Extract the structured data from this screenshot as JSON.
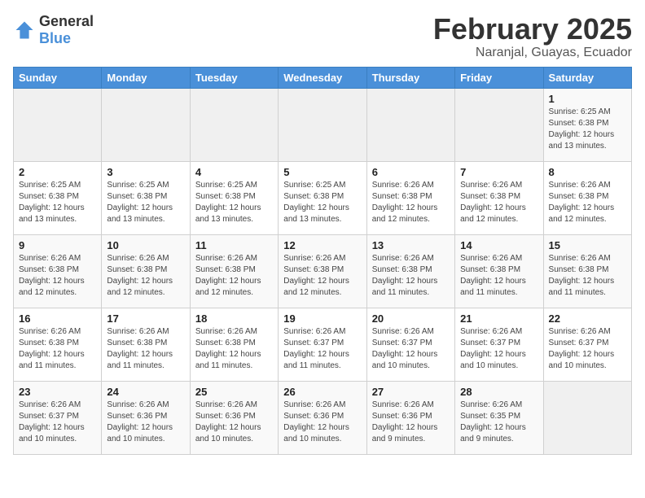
{
  "logo": {
    "general": "General",
    "blue": "Blue"
  },
  "header": {
    "month": "February 2025",
    "location": "Naranjal, Guayas, Ecuador"
  },
  "weekdays": [
    "Sunday",
    "Monday",
    "Tuesday",
    "Wednesday",
    "Thursday",
    "Friday",
    "Saturday"
  ],
  "weeks": [
    [
      {
        "day": "",
        "empty": true
      },
      {
        "day": "",
        "empty": true
      },
      {
        "day": "",
        "empty": true
      },
      {
        "day": "",
        "empty": true
      },
      {
        "day": "",
        "empty": true
      },
      {
        "day": "",
        "empty": true
      },
      {
        "day": "1",
        "sunrise": "Sunrise: 6:25 AM",
        "sunset": "Sunset: 6:38 PM",
        "daylight": "Daylight: 12 hours and 13 minutes."
      }
    ],
    [
      {
        "day": "2",
        "sunrise": "Sunrise: 6:25 AM",
        "sunset": "Sunset: 6:38 PM",
        "daylight": "Daylight: 12 hours and 13 minutes."
      },
      {
        "day": "3",
        "sunrise": "Sunrise: 6:25 AM",
        "sunset": "Sunset: 6:38 PM",
        "daylight": "Daylight: 12 hours and 13 minutes."
      },
      {
        "day": "4",
        "sunrise": "Sunrise: 6:25 AM",
        "sunset": "Sunset: 6:38 PM",
        "daylight": "Daylight: 12 hours and 13 minutes."
      },
      {
        "day": "5",
        "sunrise": "Sunrise: 6:25 AM",
        "sunset": "Sunset: 6:38 PM",
        "daylight": "Daylight: 12 hours and 13 minutes."
      },
      {
        "day": "6",
        "sunrise": "Sunrise: 6:26 AM",
        "sunset": "Sunset: 6:38 PM",
        "daylight": "Daylight: 12 hours and 12 minutes."
      },
      {
        "day": "7",
        "sunrise": "Sunrise: 6:26 AM",
        "sunset": "Sunset: 6:38 PM",
        "daylight": "Daylight: 12 hours and 12 minutes."
      },
      {
        "day": "8",
        "sunrise": "Sunrise: 6:26 AM",
        "sunset": "Sunset: 6:38 PM",
        "daylight": "Daylight: 12 hours and 12 minutes."
      }
    ],
    [
      {
        "day": "9",
        "sunrise": "Sunrise: 6:26 AM",
        "sunset": "Sunset: 6:38 PM",
        "daylight": "Daylight: 12 hours and 12 minutes."
      },
      {
        "day": "10",
        "sunrise": "Sunrise: 6:26 AM",
        "sunset": "Sunset: 6:38 PM",
        "daylight": "Daylight: 12 hours and 12 minutes."
      },
      {
        "day": "11",
        "sunrise": "Sunrise: 6:26 AM",
        "sunset": "Sunset: 6:38 PM",
        "daylight": "Daylight: 12 hours and 12 minutes."
      },
      {
        "day": "12",
        "sunrise": "Sunrise: 6:26 AM",
        "sunset": "Sunset: 6:38 PM",
        "daylight": "Daylight: 12 hours and 12 minutes."
      },
      {
        "day": "13",
        "sunrise": "Sunrise: 6:26 AM",
        "sunset": "Sunset: 6:38 PM",
        "daylight": "Daylight: 12 hours and 11 minutes."
      },
      {
        "day": "14",
        "sunrise": "Sunrise: 6:26 AM",
        "sunset": "Sunset: 6:38 PM",
        "daylight": "Daylight: 12 hours and 11 minutes."
      },
      {
        "day": "15",
        "sunrise": "Sunrise: 6:26 AM",
        "sunset": "Sunset: 6:38 PM",
        "daylight": "Daylight: 12 hours and 11 minutes."
      }
    ],
    [
      {
        "day": "16",
        "sunrise": "Sunrise: 6:26 AM",
        "sunset": "Sunset: 6:38 PM",
        "daylight": "Daylight: 12 hours and 11 minutes."
      },
      {
        "day": "17",
        "sunrise": "Sunrise: 6:26 AM",
        "sunset": "Sunset: 6:38 PM",
        "daylight": "Daylight: 12 hours and 11 minutes."
      },
      {
        "day": "18",
        "sunrise": "Sunrise: 6:26 AM",
        "sunset": "Sunset: 6:38 PM",
        "daylight": "Daylight: 12 hours and 11 minutes."
      },
      {
        "day": "19",
        "sunrise": "Sunrise: 6:26 AM",
        "sunset": "Sunset: 6:37 PM",
        "daylight": "Daylight: 12 hours and 11 minutes."
      },
      {
        "day": "20",
        "sunrise": "Sunrise: 6:26 AM",
        "sunset": "Sunset: 6:37 PM",
        "daylight": "Daylight: 12 hours and 10 minutes."
      },
      {
        "day": "21",
        "sunrise": "Sunrise: 6:26 AM",
        "sunset": "Sunset: 6:37 PM",
        "daylight": "Daylight: 12 hours and 10 minutes."
      },
      {
        "day": "22",
        "sunrise": "Sunrise: 6:26 AM",
        "sunset": "Sunset: 6:37 PM",
        "daylight": "Daylight: 12 hours and 10 minutes."
      }
    ],
    [
      {
        "day": "23",
        "sunrise": "Sunrise: 6:26 AM",
        "sunset": "Sunset: 6:37 PM",
        "daylight": "Daylight: 12 hours and 10 minutes."
      },
      {
        "day": "24",
        "sunrise": "Sunrise: 6:26 AM",
        "sunset": "Sunset: 6:36 PM",
        "daylight": "Daylight: 12 hours and 10 minutes."
      },
      {
        "day": "25",
        "sunrise": "Sunrise: 6:26 AM",
        "sunset": "Sunset: 6:36 PM",
        "daylight": "Daylight: 12 hours and 10 minutes."
      },
      {
        "day": "26",
        "sunrise": "Sunrise: 6:26 AM",
        "sunset": "Sunset: 6:36 PM",
        "daylight": "Daylight: 12 hours and 10 minutes."
      },
      {
        "day": "27",
        "sunrise": "Sunrise: 6:26 AM",
        "sunset": "Sunset: 6:36 PM",
        "daylight": "Daylight: 12 hours and 9 minutes."
      },
      {
        "day": "28",
        "sunrise": "Sunrise: 6:26 AM",
        "sunset": "Sunset: 6:35 PM",
        "daylight": "Daylight: 12 hours and 9 minutes."
      },
      {
        "day": "",
        "empty": true
      }
    ]
  ]
}
